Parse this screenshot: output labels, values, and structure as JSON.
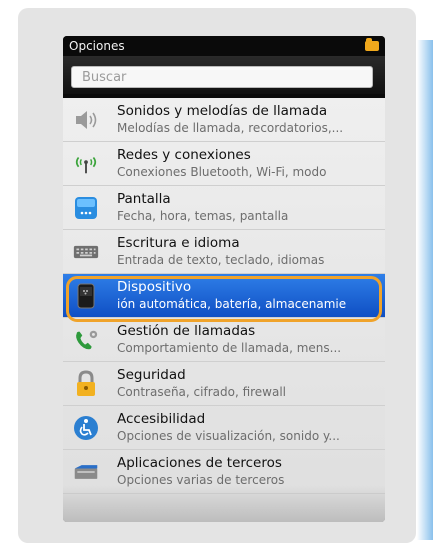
{
  "header": {
    "title": "Opciones"
  },
  "search": {
    "placeholder": "Buscar"
  },
  "items": [
    {
      "title": "Sonidos y melodías de llamada",
      "subtitle": "Melodías de llamada, recordatorios,...",
      "icon": "speaker-icon"
    },
    {
      "title": "Redes y conexiones",
      "subtitle": "Conexiones Bluetooth, Wi-Fi, modo",
      "icon": "antenna-icon"
    },
    {
      "title": "Pantalla",
      "subtitle": "Fecha, hora, temas, pantalla",
      "icon": "display-icon"
    },
    {
      "title": "Escritura e idioma",
      "subtitle": "Entrada de texto, teclado, idiomas",
      "icon": "keyboard-icon"
    },
    {
      "title": "Dispositivo",
      "subtitle": "ión automática, batería, almacenamie",
      "icon": "device-icon"
    },
    {
      "title": "Gestión de llamadas",
      "subtitle": "Comportamiento de llamada, mens...",
      "icon": "phone-icon"
    },
    {
      "title": "Seguridad",
      "subtitle": "Contraseña, cifrado, firewall",
      "icon": "lock-icon"
    },
    {
      "title": "Accesibilidad",
      "subtitle": "Opciones de visualización, sonido y...",
      "icon": "accessibility-icon"
    },
    {
      "title": "Aplicaciones de terceros",
      "subtitle": "Opciones varias de terceros",
      "icon": "apps-icon"
    }
  ],
  "colors": {
    "selected": "#1a5fd6",
    "highlight_ring": "#f0a32a",
    "folder": "#f0a81c"
  }
}
